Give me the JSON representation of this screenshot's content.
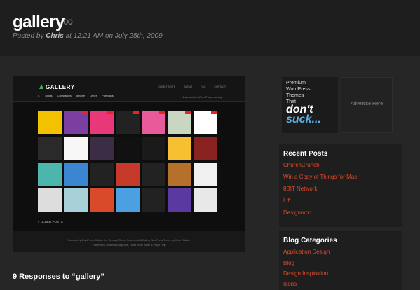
{
  "post": {
    "title": "gallery",
    "infinity": "∞",
    "meta_posted_by": "Posted by",
    "meta_author": "Chris",
    "meta_at": "at 12:21 AM on July 25th, 2009"
  },
  "screenshot": {
    "logo": "GALLERY",
    "top_links": [
      "SUBMIT A SITE",
      "ABOUT",
      "FAQ",
      "CONTACT"
    ],
    "nav": [
      "Blogs",
      "Companies",
      "Iphone",
      "Other",
      "Portfolios"
    ],
    "nav_sub": "Just another WordPress weblog",
    "older_posts": "« OLDER POSTS",
    "footer_line1": "Powered by WordPress. Built on the Thematic Theme Framework & Gallery WordPress Theme by Chris Wallace",
    "footer_line2": "Powered by Smashing Magazine, Ticket Booth Inside & Plugin Help"
  },
  "responses": "9 Responses to “gallery”",
  "ads": {
    "premium_text": [
      "Premium",
      "WordPress",
      "Themes",
      "That"
    ],
    "dont": "don't",
    "suck": "suck...",
    "advertise": "Advertise Here"
  },
  "recent_posts": {
    "heading": "Recent Posts",
    "items": [
      "ChurchCrunch",
      "Win a Copy of Things for Mac",
      "8BIT Network",
      "Lift",
      "Designmoo"
    ]
  },
  "blog_categories": {
    "heading": "Blog Categories",
    "items": [
      "Application Design",
      "Blog",
      "Design Inspiration",
      "Icons"
    ]
  },
  "colors": {
    "accent_link": "#e04b2a",
    "background": "#262626"
  }
}
